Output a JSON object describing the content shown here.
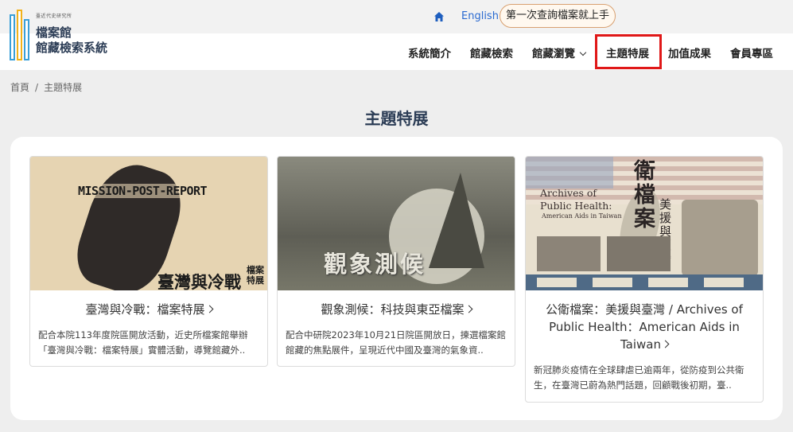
{
  "header": {
    "logo_small": "臺近代史研究所",
    "logo_title_line1": "檔案館",
    "logo_title_line2": "館藏檢索系統",
    "home_icon": "home-icon",
    "lang_link": "English",
    "first_time_button": "第一次查詢檔案就上手"
  },
  "nav": {
    "items": [
      {
        "label": "系統簡介"
      },
      {
        "label": "館藏檢索"
      },
      {
        "label": "館藏瀏覽"
      },
      {
        "label": "主題特展"
      },
      {
        "label": "加值成果"
      },
      {
        "label": "會員專區"
      }
    ]
  },
  "breadcrumb": {
    "home": "首頁",
    "separator": "/",
    "current": "主題特展"
  },
  "page": {
    "title": "主題特展"
  },
  "cards": [
    {
      "image_text_1": "MISSION-POST-REPORT",
      "image_text_2": "臺灣與冷戰",
      "image_text_3": "檔案特展",
      "title": "臺灣與冷戰：檔案特展",
      "desc": "配合本院113年度院區開放活動，近史所檔案館舉辦「臺灣與冷戰：檔案特展」實體活動，導覽館藏外.."
    },
    {
      "image_text_1": "觀象測候",
      "title": "觀象測候：科技與東亞檔案",
      "desc": "配合中研院2023年10月21日院區開放日，揀選檔案館館藏的焦點展件，呈現近代中國及臺灣的氣象資.."
    },
    {
      "image_text_1": "Archives of",
      "image_text_2": "Public Health:",
      "image_text_3": "American Aids in Taiwan",
      "image_text_4": "衛檔案",
      "image_text_5": "美援與臺灣",
      "title": "公衛檔案：美援與臺灣 / Archives of Public Health：American Aids in Taiwan",
      "desc": "新冠肺炎疫情在全球肆虐已逾兩年，從防疫到公共衛生，在臺灣已蔚為熱門話題，回顧戰後初期，臺.."
    }
  ]
}
